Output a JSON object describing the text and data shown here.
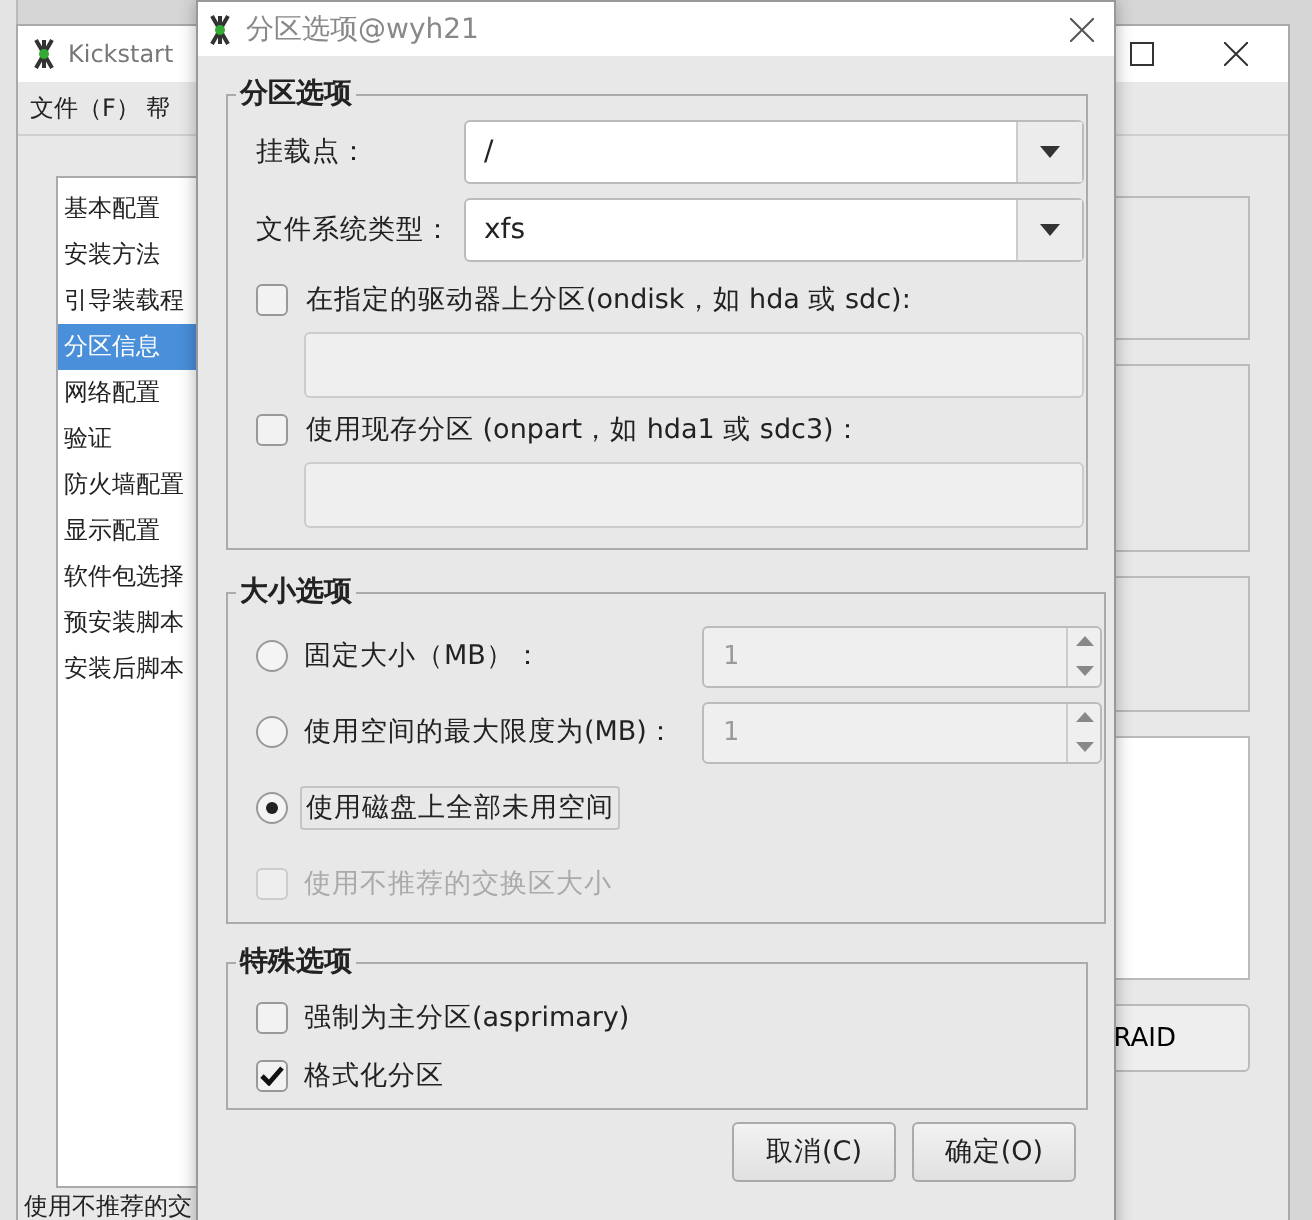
{
  "main_window": {
    "title": "Kickstart",
    "menu": [
      "文件（F）",
      "帮"
    ],
    "sidebar": [
      {
        "label": "基本配置",
        "selected": false
      },
      {
        "label": "安装方法",
        "selected": false
      },
      {
        "label": "引导装载程",
        "selected": false
      },
      {
        "label": "分区信息",
        "selected": true
      },
      {
        "label": "网络配置",
        "selected": false
      },
      {
        "label": "验证",
        "selected": false
      },
      {
        "label": "防火墙配置",
        "selected": false
      },
      {
        "label": "显示配置",
        "selected": false
      },
      {
        "label": "软件包选择",
        "selected": false
      },
      {
        "label": "预安装脚本",
        "selected": false
      },
      {
        "label": "安装后脚本",
        "selected": false
      }
    ],
    "footer_text": "使用不推荐的交",
    "raid_button": "RAID"
  },
  "dialog": {
    "title": "分区选项@wyh21",
    "partition_options": {
      "legend": "分区选项",
      "combos": [
        {
          "label": "挂载点：",
          "value": "/"
        },
        {
          "label": "文件系统类型：",
          "value": "xfs"
        }
      ],
      "checks": [
        {
          "label": "在指定的驱动器上分区(ondisk，如 hda 或 sdc):",
          "checked": false,
          "field_disabled": true
        },
        {
          "label": "使用现存分区 (onpart，如 hda1 或 sdc3)：",
          "checked": false,
          "field_disabled": true
        }
      ]
    },
    "size_options": {
      "legend": "大小选项",
      "options": [
        {
          "kind": "radio",
          "label": "固定大小（MB）：",
          "selected": false,
          "spin": "1",
          "spin_disabled": true
        },
        {
          "kind": "radio",
          "label": "使用空间的最大限度为(MB)：",
          "selected": false,
          "spin": "1",
          "spin_disabled": true
        },
        {
          "kind": "radio",
          "label": "使用磁盘上全部未用空间",
          "selected": true
        },
        {
          "kind": "checkbox",
          "label": "使用不推荐的交换区大小",
          "checked": false,
          "disabled": true
        }
      ]
    },
    "special_options": {
      "legend": "特殊选项",
      "checks": [
        {
          "label": "强制为主分区(asprimary)",
          "checked": false
        },
        {
          "label": "格式化分区",
          "checked": true
        }
      ]
    },
    "buttons": [
      "取消(C)",
      "确定(O)"
    ]
  }
}
